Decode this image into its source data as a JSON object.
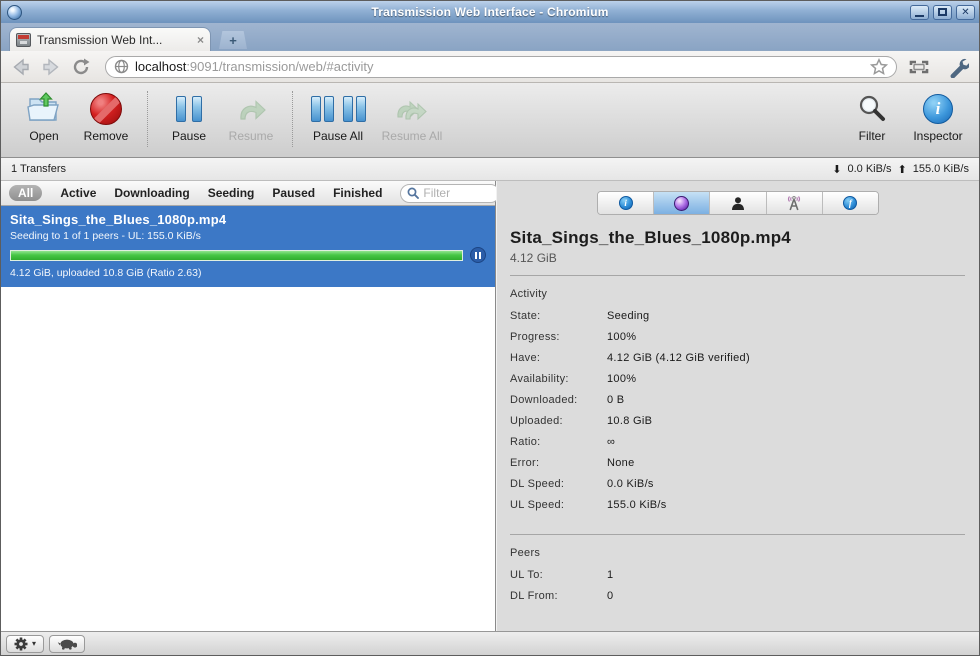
{
  "window": {
    "title": "Transmission Web Interface - Chromium"
  },
  "browser": {
    "tab_title": "Transmission Web Int...",
    "url_host": "localhost",
    "url_rest": ":9091/transmission/web/#activity"
  },
  "icons": {
    "tab_close": "×",
    "new_tab": "+",
    "window_close": "✕",
    "down_arrow": "⬇",
    "up_arrow": "⬆",
    "gear_caret": "▾",
    "info_i": "i",
    "files_f": "f",
    "inspector_i": "i"
  },
  "toolbar": {
    "buttons": [
      {
        "label": "Open",
        "disabled": false
      },
      {
        "label": "Remove",
        "disabled": false
      },
      {
        "label": "Pause",
        "disabled": false
      },
      {
        "label": "Resume",
        "disabled": true
      },
      {
        "label": "Pause All",
        "disabled": false
      },
      {
        "label": "Resume All",
        "disabled": true
      }
    ],
    "filter_label": "Filter",
    "inspector_label": "Inspector"
  },
  "statusbar": {
    "transfers": "1 Transfers",
    "down_speed": "0.0 KiB/s",
    "up_speed": "155.0 KiB/s"
  },
  "filterbar": {
    "tabs": [
      "All",
      "Active",
      "Downloading",
      "Seeding",
      "Paused",
      "Finished"
    ],
    "search_placeholder": "Filter"
  },
  "torrent": {
    "name": "Sita_Sings_the_Blues_1080p.mp4",
    "status": "Seeding to 1 of 1 peers - UL: 155.0 KiB/s",
    "progress_pct": 100,
    "detail": "4.12 GiB, uploaded 10.8 GiB (Ratio 2.63)"
  },
  "inspector": {
    "title": "Sita_Sings_the_Blues_1080p.mp4",
    "size": "4.12 GiB",
    "sections": [
      {
        "heading": "Activity",
        "rows": [
          [
            "State:",
            "Seeding"
          ],
          [
            "Progress:",
            "100%"
          ],
          [
            "Have:",
            "4.12 GiB (4.12 GiB verified)"
          ],
          [
            "Availability:",
            "100%"
          ],
          [
            "Downloaded:",
            "0 B"
          ],
          [
            "Uploaded:",
            "10.8 GiB"
          ],
          [
            "Ratio:",
            "∞"
          ],
          [
            "Error:",
            "None"
          ],
          [
            "DL Speed:",
            "0.0 KiB/s"
          ],
          [
            "UL Speed:",
            "155.0 KiB/s"
          ]
        ]
      },
      {
        "heading": "Peers",
        "rows": [
          [
            "UL To:",
            "1"
          ],
          [
            "DL From:",
            "0"
          ]
        ]
      }
    ]
  }
}
